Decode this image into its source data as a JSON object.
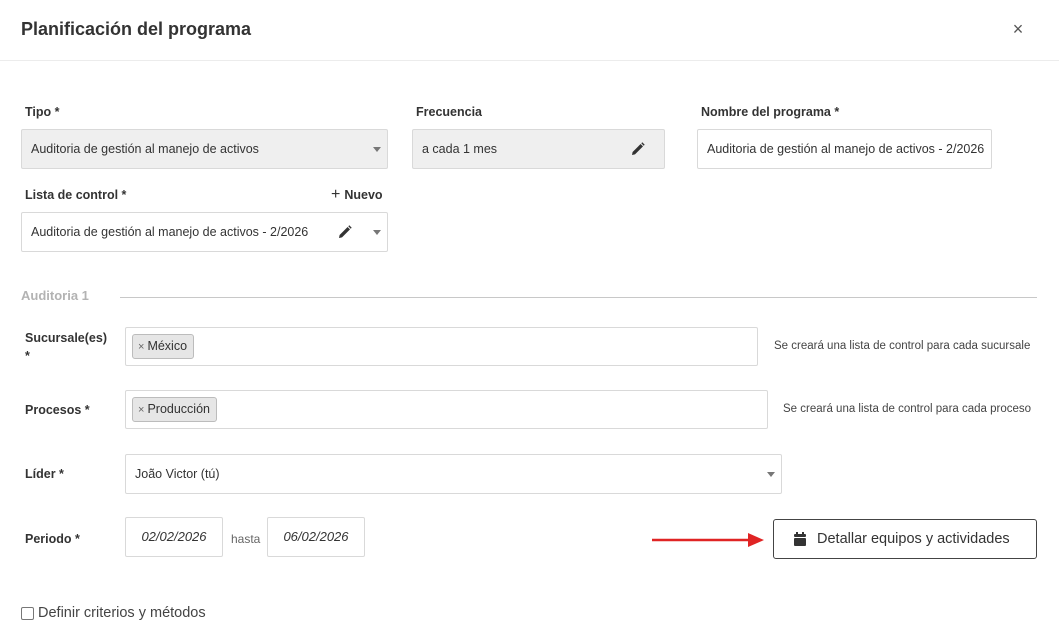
{
  "dialog": {
    "title": "Planificación del programa",
    "close_label": "×"
  },
  "tipo": {
    "label": "Tipo *",
    "value": "Auditoria de gestión al manejo de activos"
  },
  "frecuencia": {
    "label": "Frecuencia",
    "value": "a cada 1 mes"
  },
  "nombre": {
    "label": "Nombre del programa *",
    "value": "Auditoria de gestión al manejo de activos - 2/2026"
  },
  "lista": {
    "label": "Lista de control *",
    "new_label": "Nuevo",
    "value": "Auditoria de gestión al manejo de activos - 2/2026"
  },
  "section": {
    "title": "Auditoria 1"
  },
  "sucursales": {
    "label_line1": "Sucursale(es)",
    "label_line2": "*",
    "tag_remove": "×",
    "tag": "México",
    "hint": "Se creará una lista de control para cada sucursale"
  },
  "procesos": {
    "label": "Procesos *",
    "tag_remove": "×",
    "tag": "Producción",
    "hint": "Se creará una lista de control para cada proceso"
  },
  "lider": {
    "label": "Líder *",
    "value": "João Victor (tú)"
  },
  "periodo": {
    "label": "Periodo *",
    "start": "02/02/2026",
    "separator": "hasta",
    "end": "06/02/2026"
  },
  "actions": {
    "detail_button": "Detallar equipos y actividades"
  },
  "criteria": {
    "label": "Definir criterios y métodos",
    "checked": false
  },
  "colors": {
    "arrow": "#e02424",
    "disabled_bg": "#efefef",
    "border": "#d9d9d9"
  }
}
